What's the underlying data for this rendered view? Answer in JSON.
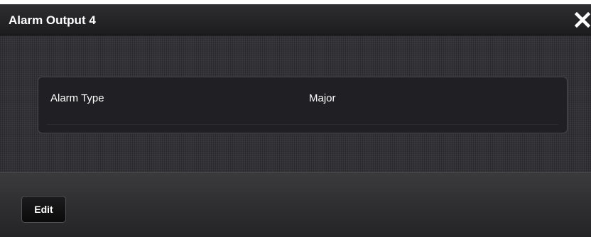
{
  "dialog": {
    "title": "Alarm Output 4",
    "close_icon": "close-icon"
  },
  "settings": {
    "alarm_type": {
      "label": "Alarm Type",
      "value": "Major"
    }
  },
  "footer": {
    "edit_label": "Edit"
  },
  "colors": {
    "titlebar": "#1c1c1e",
    "content_background": "#323237",
    "panel_background": "#1f1f24",
    "panel_border": "#47474d",
    "text": "#ffffff"
  }
}
